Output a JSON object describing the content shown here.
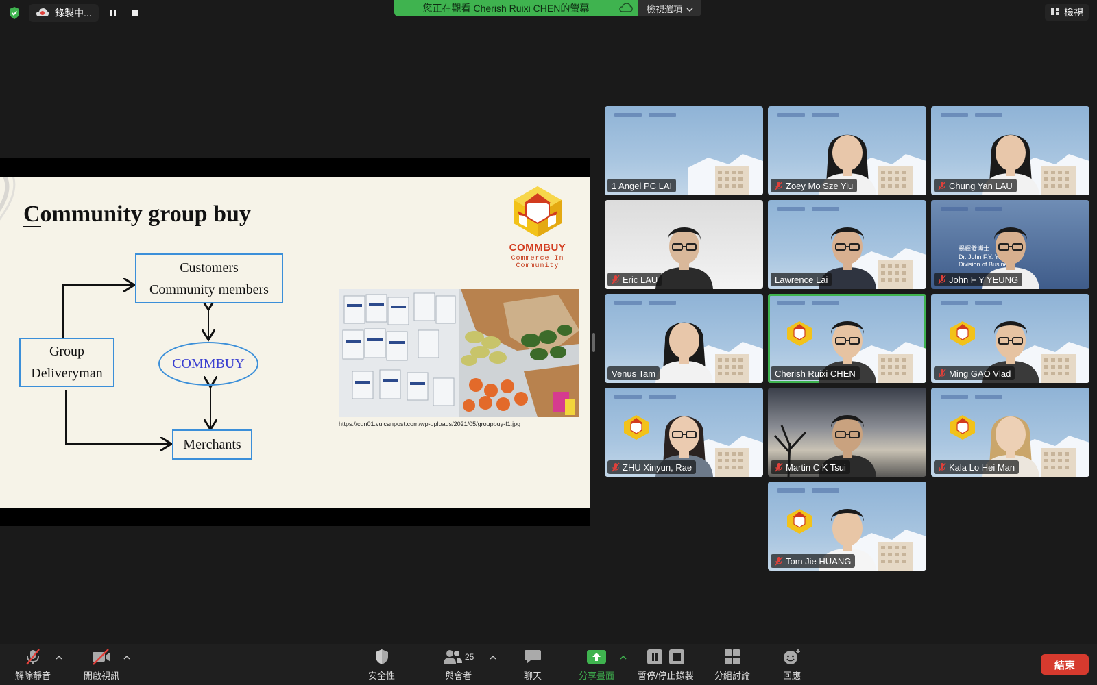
{
  "window": {
    "recording_label": "錄製中...",
    "viewing_banner": "您正在觀看 Cherish Ruixi CHEN的螢幕",
    "view_options_label": "檢視選項",
    "view_label": "檢視"
  },
  "slide": {
    "title": "Community group buy",
    "boxes": {
      "customers_line1": "Customers",
      "customers_line2": "Community members",
      "group_line1": "Group",
      "group_line2": "Deliveryman",
      "commbuy": "COMMBUY",
      "merchants": "Merchants"
    },
    "logo_name": "COMMBUY",
    "logo_tagline": "Commerce In Community",
    "photo_caption": "https://cdn01.vulcanpost.com/wp-uploads/2021/05/groupbuy-f1.jpg"
  },
  "participants": [
    {
      "name": "1 Angel PC LAI",
      "muted": false
    },
    {
      "name": "Zoey Mo Sze Yiu",
      "muted": true
    },
    {
      "name": "Chung Yan LAU",
      "muted": true
    },
    {
      "name": "Eric LAU",
      "muted": true
    },
    {
      "name": "Lawrence Lai",
      "muted": false
    },
    {
      "name": "John F Y YEUNG",
      "muted": true
    },
    {
      "name": "Venus Tam",
      "muted": false
    },
    {
      "name": "Cherish Ruixi CHEN",
      "muted": false
    },
    {
      "name": "Ming GAO  Vlad",
      "muted": true
    },
    {
      "name": "ZHU Xinyun, Rae",
      "muted": true
    },
    {
      "name": "Martin C K Tsui",
      "muted": true
    },
    {
      "name": "Kala Lo Hei Man",
      "muted": true
    },
    {
      "name": "Tom Jie HUANG",
      "muted": true
    }
  ],
  "name_card": {
    "line1": "楊輝發博士",
    "line2": "Dr. John F.Y. Yeung",
    "line3": "Division of Business"
  },
  "toolbar": {
    "unmute": "解除靜音",
    "start_video": "開啟視訊",
    "security": "安全性",
    "participants": "與會者",
    "participants_count": "25",
    "chat": "聊天",
    "share_screen": "分享畫面",
    "pause_stop_recording": "暫停/停止錄製",
    "breakout_rooms": "分組討論",
    "reactions": "回應",
    "end": "結束"
  },
  "colors": {
    "share_green": "#3fb34f",
    "end_red": "#d63a2e",
    "slide_blue": "#3b8fd9",
    "brand_orange": "#d23b1e"
  }
}
